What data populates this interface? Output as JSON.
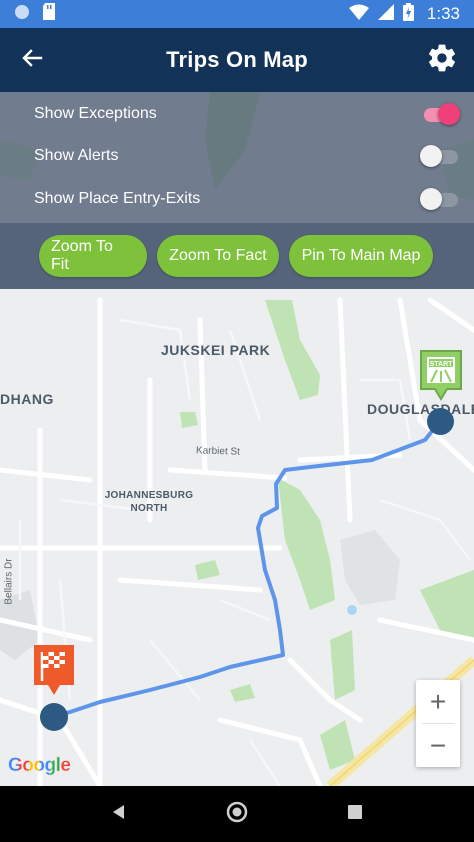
{
  "status_bar": {
    "time": "1:33",
    "icons": [
      "circle-notification-icon",
      "sd-card-icon",
      "wifi-icon",
      "signal-icon",
      "battery-charging-icon"
    ]
  },
  "app_bar": {
    "title": "Trips On Map",
    "back_icon": "arrow-back-icon",
    "settings_icon": "gear-icon"
  },
  "toggles": [
    {
      "label": "Show Exceptions",
      "on": true
    },
    {
      "label": "Show Alerts",
      "on": false
    },
    {
      "label": "Show Place Entry-Exits",
      "on": false
    }
  ],
  "buttons": {
    "zoom_fit": "Zoom To Fit",
    "zoom_fact": "Zoom To Fact",
    "pin_main": "Pin To Main Map"
  },
  "map": {
    "labels": {
      "jukskei": "JUKSKEI PARK",
      "dhang": "DHANG",
      "douglasdale": "DOUGLASDALE",
      "jhb_north_1": "JOHANNESBURG",
      "jhb_north_2": "NORTH",
      "karbiet": "Karbiet St",
      "bellairs": "Bellairs Dr"
    },
    "start_marker_text": "START",
    "google": "Google",
    "zoom_in": "+",
    "zoom_out": "−"
  },
  "colors": {
    "status_bar": "#3d7ed8",
    "app_bar": "#123258",
    "accent_green": "#7ec23c",
    "route_blue": "#5e95ea",
    "toggle_on": "#f0407a",
    "finish_marker": "#ef5a2a",
    "endpoint_dot": "#2c5a82"
  },
  "nav": {
    "back": "nav-back-icon",
    "home": "nav-home-icon",
    "recents": "nav-recents-icon"
  }
}
